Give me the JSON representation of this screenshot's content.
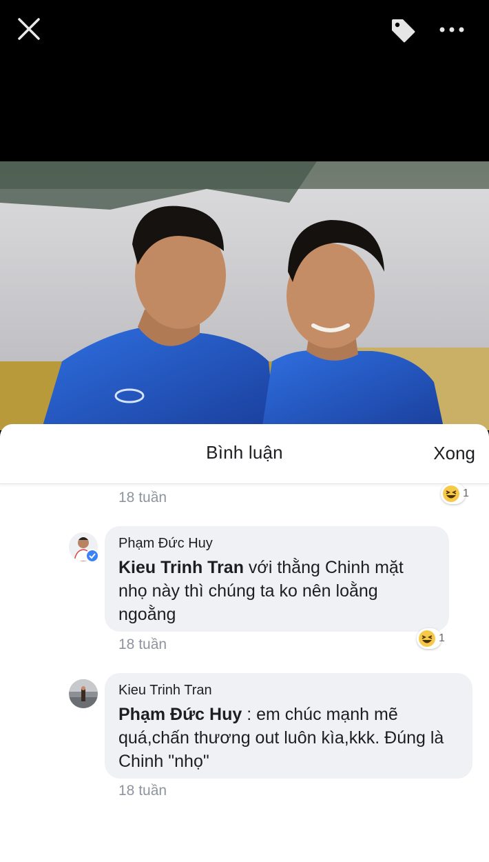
{
  "sheet": {
    "title": "Bình luận",
    "done_label": "Xong"
  },
  "comments": [
    {
      "time": "18 tuần",
      "reaction_count": "1"
    },
    {
      "author": "Phạm Đức Huy",
      "mention": "Kieu Trinh Tran",
      "text_line1": " với thằng Chinh mặt",
      "text_rest": "nhọ này thì chúng ta ko nên loằng ngoằng",
      "time": "18 tuần",
      "reaction_count": "1"
    },
    {
      "author": "Kieu Trinh Tran",
      "mention": "Phạm Đức Huy",
      "text_line1": " : em chúc mạnh mẽ",
      "text_rest": "quá,chấn thương out luôn kìa,kkk. Đúng là Chinh \"nhọ\"",
      "time": "18 tuần"
    }
  ],
  "icons": {
    "close": "close-icon",
    "tag": "tag-icon",
    "more": "more-icon",
    "reaction": "haha-emoji-icon"
  },
  "colors": {
    "background": "#000000",
    "sheet": "#ffffff",
    "bubble": "#f0f1f4",
    "text": "#1c1e21",
    "muted": "#8d949e"
  }
}
